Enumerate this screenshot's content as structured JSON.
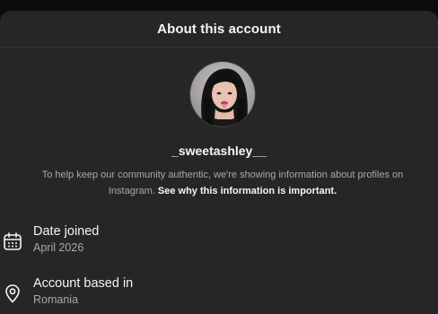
{
  "modal": {
    "title": "About this account"
  },
  "profile": {
    "username": "_sweetashley__",
    "avatar_description": "profile-photo"
  },
  "info": {
    "text": "To help keep our community authentic, we're showing information about profiles on Instagram. ",
    "link": "See why this information is important."
  },
  "details": {
    "date_joined": {
      "label": "Date joined",
      "value": "April 2026",
      "icon": "calendar-icon"
    },
    "based_in": {
      "label": "Account based in",
      "value": "Romania",
      "icon": "location-pin-icon"
    }
  },
  "colors": {
    "modal_bg": "#262628",
    "text_primary": "#f5f5f5",
    "text_secondary": "#a8a8a8"
  }
}
